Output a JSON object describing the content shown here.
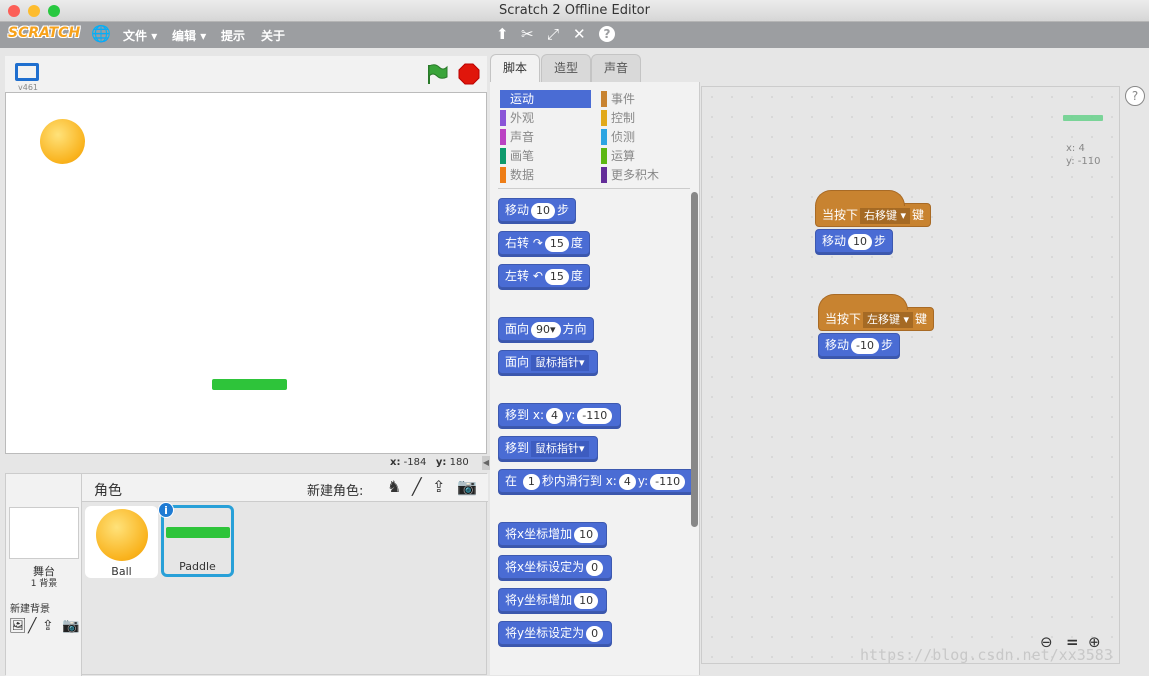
{
  "window": {
    "title": "Scratch 2 Offline Editor"
  },
  "menubar": {
    "logo": "SCRATCH",
    "items": [
      "文件",
      "编辑",
      "提示",
      "关于"
    ]
  },
  "stage": {
    "version": "v461",
    "mouse_x_label": "x:",
    "mouse_x": "-184",
    "mouse_y_label": "y:",
    "mouse_y": "180"
  },
  "sprites": {
    "header": "角色",
    "new_sprite_label": "新建角色:",
    "stage_label": "舞台",
    "stage_backdrops": "1 背景",
    "new_backdrop_label": "新建背景",
    "items": [
      {
        "name": "Ball"
      },
      {
        "name": "Paddle"
      }
    ]
  },
  "tabs": [
    "脚本",
    "造型",
    "声音"
  ],
  "categories": [
    {
      "label": "运动",
      "color": "#4a6cd4"
    },
    {
      "label": "外观",
      "color": "#8a55d7"
    },
    {
      "label": "声音",
      "color": "#bb42c3"
    },
    {
      "label": "画笔",
      "color": "#0e9a6c"
    },
    {
      "label": "数据",
      "color": "#ee7d16"
    },
    {
      "label": "事件",
      "color": "#c88330"
    },
    {
      "label": "控制",
      "color": "#e1a91a"
    },
    {
      "label": "侦测",
      "color": "#2ca5e2"
    },
    {
      "label": "运算",
      "color": "#5cb712"
    },
    {
      "label": "更多积木",
      "color": "#632d99"
    }
  ],
  "blocks": {
    "move": {
      "a": "移动",
      "n": "10",
      "b": "步"
    },
    "turn_right": {
      "a": "右转",
      "n": "15",
      "b": "度"
    },
    "turn_left": {
      "a": "左转",
      "n": "15",
      "b": "度"
    },
    "point_dir": {
      "a": "面向",
      "n": "90",
      "b": "方向"
    },
    "point_towards": {
      "a": "面向",
      "d": "鼠标指针"
    },
    "goto_xy": {
      "a": "移到",
      "x": "x:",
      "xv": "4",
      "y": "y:",
      "yv": "-110"
    },
    "goto": {
      "a": "移到",
      "d": "鼠标指针"
    },
    "glide": {
      "a": "在",
      "n": "1",
      "b": "秒内滑行到",
      "x": "x:",
      "xv": "4",
      "y": "y:",
      "yv": "-110"
    },
    "change_x": {
      "a": "将x坐标增加",
      "n": "10"
    },
    "set_x": {
      "a": "将x坐标设定为",
      "n": "0"
    },
    "change_y": {
      "a": "将y坐标增加",
      "n": "10"
    },
    "set_y": {
      "a": "将y坐标设定为",
      "n": "0"
    }
  },
  "scripts": {
    "sprite_x": "x: 4",
    "sprite_y": "y: -110",
    "s1": {
      "hat_a": "当按下",
      "key": "右移键",
      "hat_b": "键",
      "mv": "移动",
      "n": "10",
      "st": "步"
    },
    "s2": {
      "hat_a": "当按下",
      "key": "左移键",
      "hat_b": "键",
      "mv": "移动",
      "n": "-10",
      "st": "步"
    }
  },
  "watermark": "https://blog.csdn.net/xx3583"
}
